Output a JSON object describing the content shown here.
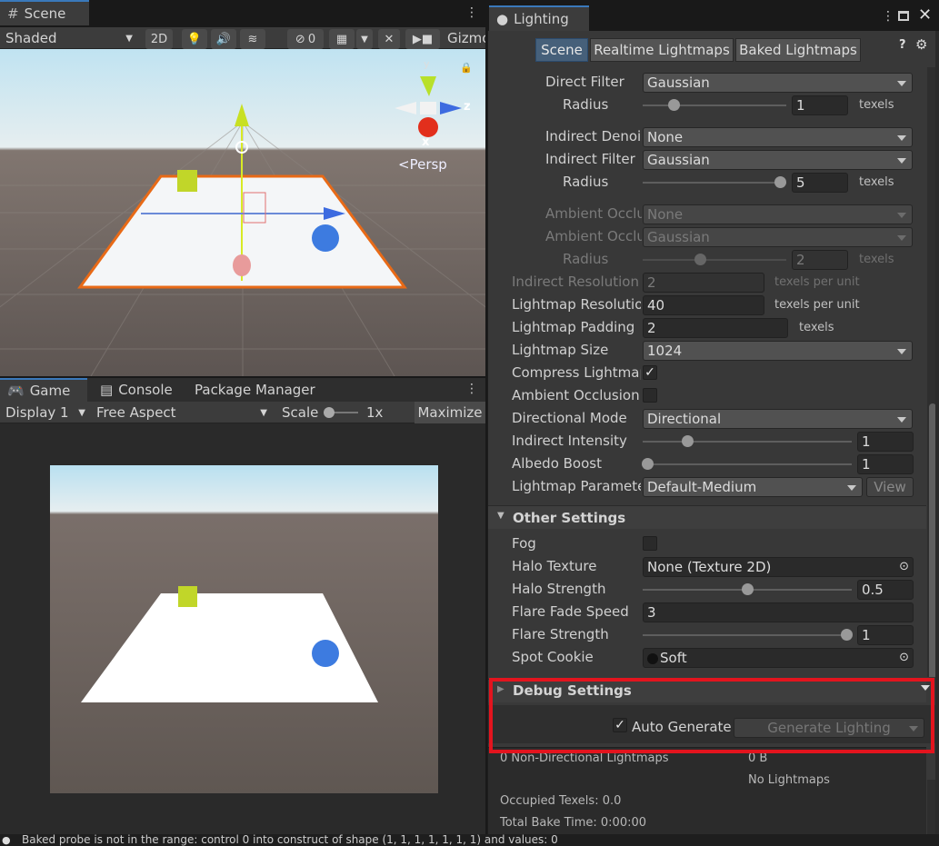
{
  "scene": {
    "tab_label": "Scene",
    "shading_mode": "Shaded",
    "btn_2d": "2D",
    "hidden_count": "0",
    "gizmos_label": "Gizmos",
    "persp_label": "Persp",
    "axis_x": "x",
    "axis_y": "y",
    "axis_z": "z"
  },
  "game": {
    "tabs": [
      "Game",
      "Console",
      "Package Manager"
    ],
    "display": "Display 1",
    "aspect": "Free Aspect",
    "scale_label": "Scale",
    "scale_value": "1x",
    "maximize_label": "Maximize"
  },
  "lighting": {
    "window_title": "Lighting",
    "tabs": [
      "Scene",
      "Realtime Lightmaps",
      "Baked Lightmaps"
    ],
    "rows": {
      "direct_filter": {
        "label": "Direct Filter",
        "value": "Gaussian"
      },
      "direct_radius": {
        "label": "Radius",
        "value": "1",
        "unit": "texels"
      },
      "indirect_denoiser": {
        "label": "Indirect Denoiser",
        "value": "None"
      },
      "indirect_filter": {
        "label": "Indirect Filter",
        "value": "Gaussian"
      },
      "indirect_radius": {
        "label": "Radius",
        "value": "5",
        "unit": "texels"
      },
      "ambient_denoiser": {
        "label": "Ambient Occlusion Denoiser",
        "value": "None"
      },
      "ambient_filter": {
        "label": "Ambient Occlusion Filter",
        "value": "Gaussian"
      },
      "ambient_radius": {
        "label": "Radius",
        "value": "2",
        "unit": "texels"
      },
      "indirect_resolution": {
        "label": "Indirect Resolution",
        "value": "2",
        "unit": "texels per unit"
      },
      "lightmap_resolution": {
        "label": "Lightmap Resolution",
        "value": "40",
        "unit": "texels per unit"
      },
      "lightmap_padding": {
        "label": "Lightmap Padding",
        "value": "2",
        "unit": "texels"
      },
      "lightmap_size": {
        "label": "Lightmap Size",
        "value": "1024"
      },
      "compress_lightmaps": {
        "label": "Compress Lightmaps",
        "checked": true
      },
      "ambient_occlusion": {
        "label": "Ambient Occlusion",
        "checked": false
      },
      "directional_mode": {
        "label": "Directional Mode",
        "value": "Directional"
      },
      "indirect_intensity": {
        "label": "Indirect Intensity",
        "value": "1"
      },
      "albedo_boost": {
        "label": "Albedo Boost",
        "value": "1"
      },
      "lightmap_parameters": {
        "label": "Lightmap Parameters",
        "value": "Default-Medium",
        "button": "View"
      }
    },
    "other_settings": {
      "header": "Other Settings",
      "fog": {
        "label": "Fog",
        "checked": false
      },
      "halo_texture": {
        "label": "Halo Texture",
        "value": "None (Texture 2D)"
      },
      "halo_strength": {
        "label": "Halo Strength",
        "value": "0.5"
      },
      "flare_fade_speed": {
        "label": "Flare Fade Speed",
        "value": "3"
      },
      "flare_strength": {
        "label": "Flare Strength",
        "value": "1"
      },
      "spot_cookie": {
        "label": "Spot Cookie",
        "value": "Soft"
      }
    },
    "debug": {
      "header": "Debug Settings",
      "auto_generate": "Auto Generate",
      "generate_lighting": "Generate Lighting"
    },
    "stats": {
      "lightmaps": "0 Non-Directional Lightmaps",
      "size": "0 B",
      "no_lightmaps": "No Lightmaps",
      "occupied": "Occupied Texels: 0.0",
      "bake_time": "Total Bake Time: 0:00:00"
    },
    "highlight_color": "#e3141e"
  },
  "status_bar": {
    "message": "Baked probe is not in the range: control 0 into construct of shape (1, 1, 1, 1, 1, 1, 1) and values: 0"
  }
}
